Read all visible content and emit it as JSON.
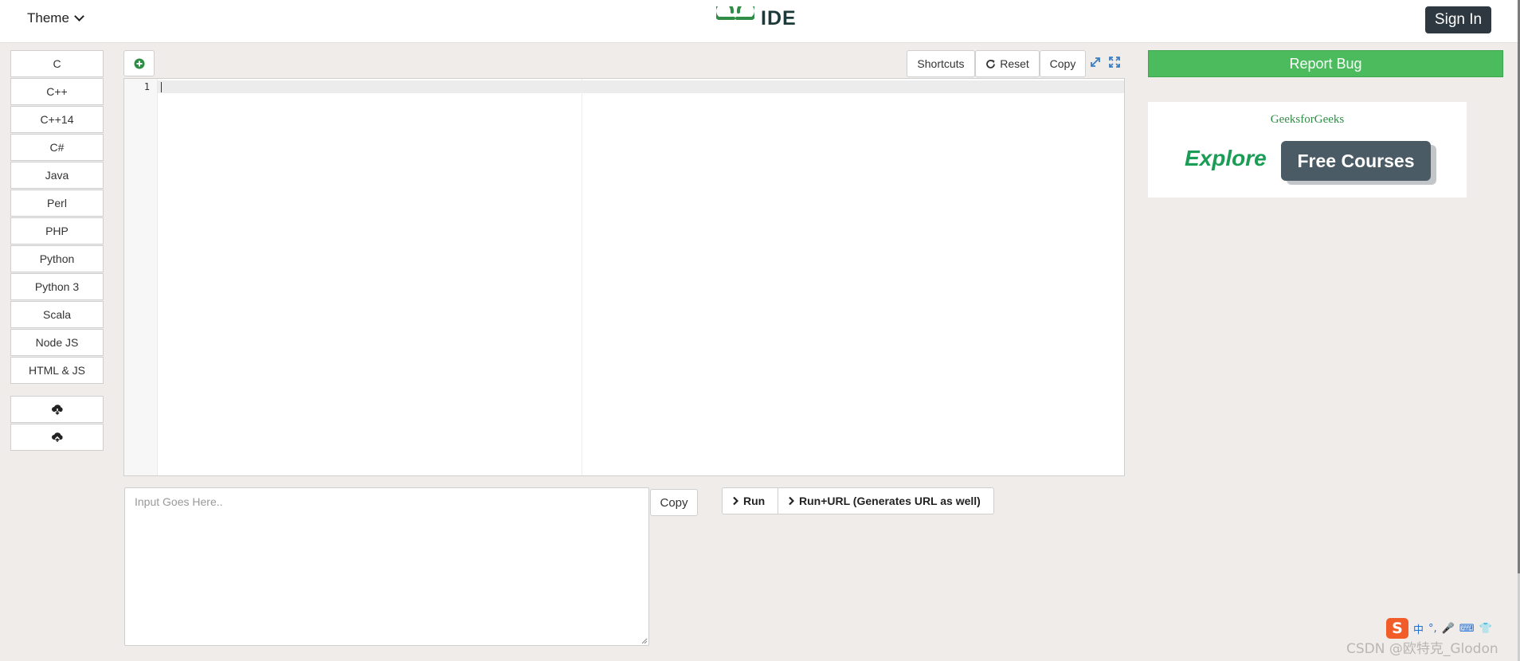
{
  "header": {
    "theme_label": "Theme",
    "logo_text": "IDE",
    "signin_label": "Sign In"
  },
  "languages": [
    "C",
    "C++",
    "C++14",
    "C#",
    "Java",
    "Perl",
    "PHP",
    "Python",
    "Python 3",
    "Scala",
    "Node JS",
    "HTML & JS"
  ],
  "toolbar": {
    "shortcuts_label": "Shortcuts",
    "reset_label": "Reset",
    "copy_label": "Copy"
  },
  "editor": {
    "line_number": "1"
  },
  "input": {
    "placeholder": "Input Goes Here..",
    "copy_label": "Copy"
  },
  "run": {
    "run_label": "Run",
    "run_url_label": "Run+URL (Generates URL as well)"
  },
  "sidebar_right": {
    "report_bug_label": "Report Bug",
    "ad_brand": "GeeksforGeeks",
    "ad_explore": "Explore",
    "ad_button": "Free Courses"
  },
  "overlay": {
    "ime_items": [
      "中",
      "°,",
      "🎤",
      "⌨",
      "👕"
    ],
    "watermark": "CSDN @欧特克_Glodon"
  },
  "colors": {
    "background": "#efece9",
    "accent_green": "#4cbb5e",
    "logo_green": "#2f8d46",
    "signin_dark": "#2e3840"
  },
  "icons": {
    "add": "plus-circle-icon",
    "reset": "refresh-icon",
    "expand": "expand-icon",
    "fullscreen": "fullscreen-icon",
    "download": "cloud-download-icon",
    "upload": "cloud-upload-icon",
    "run": "chevron-right-icon"
  }
}
